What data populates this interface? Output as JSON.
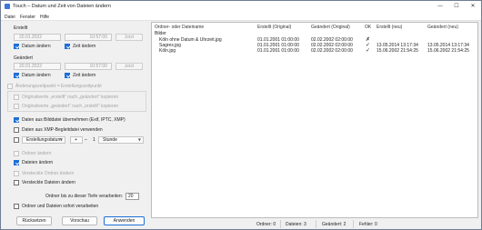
{
  "window": {
    "title": "Touch – Datum und Zeit von Dateien ändern",
    "controls": {
      "minimize": "—",
      "maximize": "☐",
      "close": "✕"
    }
  },
  "menu": [
    "Datei",
    "Fenster",
    "Hilfe"
  ],
  "erstellt": {
    "label": "Erstellt",
    "date": "20.01.2022",
    "time": "10:57:00",
    "now_label": "Jetzt",
    "date_check": "Datum ändern",
    "time_check": "Zeit ändern"
  },
  "geaendert": {
    "label": "Geändert",
    "date": "20.01.2022",
    "time": "10:57:00",
    "now_label": "Jetzt",
    "date_check": "Datum ändern",
    "time_check": "Zeit ändern"
  },
  "options": {
    "sync_check": "Änderungszeitpunkt = Erstellungszeitpunkt",
    "copy_created": "Originalwerte „erstellt“ nach „geändert“ kopieren",
    "copy_changed": "Originalwerte „geändert“ nach „erstellt“ kopieren",
    "exif_check": "Daten aus Bilddatei übernehmen (Exif, IPTC, XMP)",
    "xmp_check": "Daten aus XMP-Begleitdatei verwenden",
    "offset_field": "Erstellungsdatum",
    "offset_sign": "+",
    "offset_minus": "–",
    "offset_value": "1",
    "offset_unit": "Stunde",
    "folders_check": "Ordner ändern",
    "files_check": "Dateien ändern",
    "hidden_folders": "Versteckte Ordner ändern",
    "hidden_files": "Versteckte Dateien ändern",
    "depth_label": "Ordner bis zu dieser Tiefe verarbeiten:",
    "depth_value": "20",
    "immediate_check": "Ordner und Dateien sofort verarbeiten"
  },
  "buttons": {
    "reset": "Rücksetzen",
    "preview": "Vorschau",
    "apply": "Anwenden"
  },
  "table": {
    "headers": [
      "Ordner- oder Dateiname",
      "Erstellt (Original)",
      "Geändert (Original)",
      "OK",
      "Erstellt (neu)",
      "Geändert (neu)"
    ],
    "group": "Bilder",
    "rows": [
      {
        "name": "Köln ohne Datum & Uhrzeit.jpg",
        "created": "01.01.2001  01:00:00",
        "changed": "02.02.2002  02:00:00",
        "ok": "✗",
        "new_created": "",
        "new_changed": ""
      },
      {
        "name": "Sagres.jpg",
        "created": "01.01.2001  01:00:00",
        "changed": "02.02.2002  02:00:00",
        "ok": "✓",
        "new_created": "13.05.2014  13:17:34",
        "new_changed": "13.05.2014  13:17:34"
      },
      {
        "name": "Köln.jpg",
        "created": "01.01.2001  01:00:00",
        "changed": "02.02.2002  02:00:00",
        "ok": "✓",
        "new_created": "15.06.2002  21:54:25",
        "new_changed": "15.06.2002  21:54:25"
      }
    ]
  },
  "status": {
    "folders": "Ordner: 0",
    "files": "Dateien: 3",
    "changed": "Geändert: 2",
    "errors": "Fehler: 0"
  }
}
